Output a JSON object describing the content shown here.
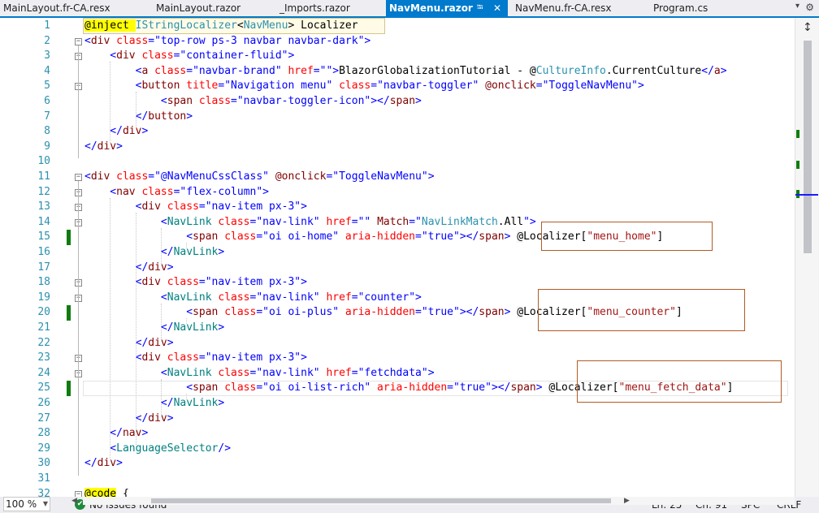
{
  "tabs": [
    {
      "label": "MainLayout.fr-CA.resx",
      "active": false
    },
    {
      "label": "MainLayout.razor",
      "active": false
    },
    {
      "label": "_Imports.razor",
      "active": false
    },
    {
      "label": "NavMenu.razor",
      "active": true,
      "pin_icon": "pin-icon",
      "close_icon": "close-icon"
    },
    {
      "label": "NavMenu.fr-CA.resx",
      "active": false
    },
    {
      "label": "Program.cs",
      "active": false
    }
  ],
  "editor": {
    "line_numbers": [
      "1",
      "2",
      "3",
      "4",
      "5",
      "6",
      "7",
      "8",
      "9",
      "10",
      "11",
      "12",
      "13",
      "14",
      "15",
      "16",
      "17",
      "18",
      "19",
      "20",
      "21",
      "22",
      "23",
      "24",
      "25",
      "26",
      "27",
      "28",
      "29",
      "30",
      "31",
      "32"
    ],
    "changed_lines": [
      15,
      20,
      25
    ],
    "current_line": 25,
    "lines": [
      [
        [
          "@inject ",
          "razor"
        ],
        [
          "IStringLocalizer",
          "type"
        ],
        [
          "<",
          "plain"
        ],
        [
          "NavMenu",
          "type"
        ],
        [
          "> Localizer",
          "plain"
        ]
      ],
      [
        [
          "<",
          "kw"
        ],
        [
          "div",
          "markup"
        ],
        [
          " class",
          "attr"
        ],
        [
          "=",
          "kw"
        ],
        [
          "\"top-row ps-3 navbar navbar-dark\"",
          "str"
        ],
        [
          ">",
          "kw"
        ]
      ],
      [
        [
          "    <",
          "kw"
        ],
        [
          "div",
          "markup"
        ],
        [
          " class",
          "attr"
        ],
        [
          "=",
          "kw"
        ],
        [
          "\"container-fluid\"",
          "str"
        ],
        [
          ">",
          "kw"
        ]
      ],
      [
        [
          "        <",
          "kw"
        ],
        [
          "a",
          "markup"
        ],
        [
          " class",
          "attr"
        ],
        [
          "=",
          "kw"
        ],
        [
          "\"navbar-brand\"",
          "str"
        ],
        [
          " href",
          "attr"
        ],
        [
          "=",
          "kw"
        ],
        [
          "\"\"",
          "str"
        ],
        [
          ">",
          "kw"
        ],
        [
          "BlazorGlobalizationTutorial - ",
          "plain"
        ],
        [
          "@",
          "razor"
        ],
        [
          "CultureInfo",
          "type"
        ],
        [
          ".CurrentCulture",
          "plain"
        ],
        [
          "</",
          "kw"
        ],
        [
          "a",
          "markup"
        ],
        [
          ">",
          "kw"
        ]
      ],
      [
        [
          "        <",
          "kw"
        ],
        [
          "button",
          "markup"
        ],
        [
          " title",
          "attr"
        ],
        [
          "=",
          "kw"
        ],
        [
          "\"Navigation menu\"",
          "str"
        ],
        [
          " class",
          "attr"
        ],
        [
          "=",
          "kw"
        ],
        [
          "\"navbar-toggler\"",
          "str"
        ],
        [
          " @onclick",
          "markup"
        ],
        [
          "=",
          "kw"
        ],
        [
          "\"ToggleNavMenu\"",
          "str"
        ],
        [
          ">",
          "kw"
        ]
      ],
      [
        [
          "            <",
          "kw"
        ],
        [
          "span",
          "markup"
        ],
        [
          " class",
          "attr"
        ],
        [
          "=",
          "kw"
        ],
        [
          "\"navbar-toggler-icon\"",
          "str"
        ],
        [
          "></",
          "kw"
        ],
        [
          "span",
          "markup"
        ],
        [
          ">",
          "kw"
        ]
      ],
      [
        [
          "        </",
          "kw"
        ],
        [
          "button",
          "markup"
        ],
        [
          ">",
          "kw"
        ]
      ],
      [
        [
          "    </",
          "kw"
        ],
        [
          "div",
          "markup"
        ],
        [
          ">",
          "kw"
        ]
      ],
      [
        [
          "</",
          "kw"
        ],
        [
          "div",
          "markup"
        ],
        [
          ">",
          "kw"
        ]
      ],
      [
        [
          "",
          "plain"
        ]
      ],
      [
        [
          "<",
          "kw"
        ],
        [
          "div",
          "markup"
        ],
        [
          " class",
          "attr"
        ],
        [
          "=",
          "kw"
        ],
        [
          "\"@NavMenuCssClass\"",
          "str"
        ],
        [
          " @onclick",
          "markup"
        ],
        [
          "=",
          "kw"
        ],
        [
          "\"ToggleNavMenu\"",
          "str"
        ],
        [
          ">",
          "kw"
        ]
      ],
      [
        [
          "    <",
          "kw"
        ],
        [
          "nav",
          "markup"
        ],
        [
          " class",
          "attr"
        ],
        [
          "=",
          "kw"
        ],
        [
          "\"flex-column\"",
          "str"
        ],
        [
          ">",
          "kw"
        ]
      ],
      [
        [
          "        <",
          "kw"
        ],
        [
          "div",
          "markup"
        ],
        [
          " class",
          "attr"
        ],
        [
          "=",
          "kw"
        ],
        [
          "\"nav-item px-3\"",
          "str"
        ],
        [
          ">",
          "kw"
        ]
      ],
      [
        [
          "            <",
          "kw"
        ],
        [
          "NavLink",
          "comp"
        ],
        [
          " class",
          "attr"
        ],
        [
          "=",
          "kw"
        ],
        [
          "\"nav-link\"",
          "str"
        ],
        [
          " href",
          "attr"
        ],
        [
          "=",
          "kw"
        ],
        [
          "\"\"",
          "str"
        ],
        [
          " Match",
          "markup"
        ],
        [
          "=",
          "kw"
        ],
        [
          "\"",
          "str"
        ],
        [
          "NavLinkMatch",
          "type"
        ],
        [
          ".All",
          "plain"
        ],
        [
          "\">",
          "kw"
        ]
      ],
      [
        [
          "                <",
          "kw"
        ],
        [
          "span",
          "markup"
        ],
        [
          " class",
          "attr"
        ],
        [
          "=",
          "kw"
        ],
        [
          "\"oi oi-home\"",
          "str"
        ],
        [
          " aria-hidden",
          "attr"
        ],
        [
          "=",
          "kw"
        ],
        [
          "\"true\"",
          "str"
        ],
        [
          "></",
          "kw"
        ],
        [
          "span",
          "markup"
        ],
        [
          "> ",
          "kw"
        ],
        [
          "@",
          "razor"
        ],
        [
          "Localizer[",
          "plain"
        ],
        [
          "\"menu_home\"",
          "str-red"
        ],
        [
          "]",
          "plain"
        ]
      ],
      [
        [
          "            </",
          "kw"
        ],
        [
          "NavLink",
          "comp"
        ],
        [
          ">",
          "kw"
        ]
      ],
      [
        [
          "        </",
          "kw"
        ],
        [
          "div",
          "markup"
        ],
        [
          ">",
          "kw"
        ]
      ],
      [
        [
          "        <",
          "kw"
        ],
        [
          "div",
          "markup"
        ],
        [
          " class",
          "attr"
        ],
        [
          "=",
          "kw"
        ],
        [
          "\"nav-item px-3\"",
          "str"
        ],
        [
          ">",
          "kw"
        ]
      ],
      [
        [
          "            <",
          "kw"
        ],
        [
          "NavLink",
          "comp"
        ],
        [
          " class",
          "attr"
        ],
        [
          "=",
          "kw"
        ],
        [
          "\"nav-link\"",
          "str"
        ],
        [
          " href",
          "attr"
        ],
        [
          "=",
          "kw"
        ],
        [
          "\"counter\"",
          "str"
        ],
        [
          ">",
          "kw"
        ]
      ],
      [
        [
          "                <",
          "kw"
        ],
        [
          "span",
          "markup"
        ],
        [
          " class",
          "attr"
        ],
        [
          "=",
          "kw"
        ],
        [
          "\"oi oi-plus\"",
          "str"
        ],
        [
          " aria-hidden",
          "attr"
        ],
        [
          "=",
          "kw"
        ],
        [
          "\"true\"",
          "str"
        ],
        [
          "></",
          "kw"
        ],
        [
          "span",
          "markup"
        ],
        [
          "> ",
          "kw"
        ],
        [
          "@",
          "razor"
        ],
        [
          "Localizer[",
          "plain"
        ],
        [
          "\"menu_counter\"",
          "str-red"
        ],
        [
          "]",
          "plain"
        ]
      ],
      [
        [
          "            </",
          "kw"
        ],
        [
          "NavLink",
          "comp"
        ],
        [
          ">",
          "kw"
        ]
      ],
      [
        [
          "        </",
          "kw"
        ],
        [
          "div",
          "markup"
        ],
        [
          ">",
          "kw"
        ]
      ],
      [
        [
          "        <",
          "kw"
        ],
        [
          "div",
          "markup"
        ],
        [
          " class",
          "attr"
        ],
        [
          "=",
          "kw"
        ],
        [
          "\"nav-item px-3\"",
          "str"
        ],
        [
          ">",
          "kw"
        ]
      ],
      [
        [
          "            <",
          "kw"
        ],
        [
          "NavLink",
          "comp"
        ],
        [
          " class",
          "attr"
        ],
        [
          "=",
          "kw"
        ],
        [
          "\"nav-link\"",
          "str"
        ],
        [
          " href",
          "attr"
        ],
        [
          "=",
          "kw"
        ],
        [
          "\"fetchdata\"",
          "str"
        ],
        [
          ">",
          "kw"
        ]
      ],
      [
        [
          "                <",
          "kw"
        ],
        [
          "span",
          "markup"
        ],
        [
          " class",
          "attr"
        ],
        [
          "=",
          "kw"
        ],
        [
          "\"oi oi-list-rich\"",
          "str"
        ],
        [
          " aria-hidden",
          "attr"
        ],
        [
          "=",
          "kw"
        ],
        [
          "\"true\"",
          "str"
        ],
        [
          "></",
          "kw"
        ],
        [
          "span",
          "markup"
        ],
        [
          "> ",
          "kw"
        ],
        [
          "@",
          "razor"
        ],
        [
          "Localizer[",
          "plain"
        ],
        [
          "\"menu_fetch_data\"",
          "str-red"
        ],
        [
          "]",
          "plain"
        ]
      ],
      [
        [
          "            </",
          "kw"
        ],
        [
          "NavLink",
          "comp"
        ],
        [
          ">",
          "kw"
        ]
      ],
      [
        [
          "        </",
          "kw"
        ],
        [
          "div",
          "markup"
        ],
        [
          ">",
          "kw"
        ]
      ],
      [
        [
          "    </",
          "kw"
        ],
        [
          "nav",
          "markup"
        ],
        [
          ">",
          "kw"
        ]
      ],
      [
        [
          "    <",
          "kw"
        ],
        [
          "LanguageSelector",
          "comp"
        ],
        [
          "/>",
          "kw"
        ]
      ],
      [
        [
          "</",
          "kw"
        ],
        [
          "div",
          "markup"
        ],
        [
          ">",
          "kw"
        ]
      ],
      [
        [
          "",
          "plain"
        ]
      ],
      [
        [
          "@code",
          "razor"
        ],
        [
          " {",
          "plain"
        ]
      ]
    ]
  },
  "statusbar": {
    "zoom": "100 %",
    "issues_icon": "check-circle-icon",
    "issues_text": "No issues found",
    "line": "Ln: 25",
    "char": "Ch: 91",
    "insert_mode": "SPC",
    "line_ending": "CRLF"
  },
  "colors": {
    "accent": "#007acc",
    "change_bar": "#107c10",
    "callout_border": "#b15b24"
  }
}
